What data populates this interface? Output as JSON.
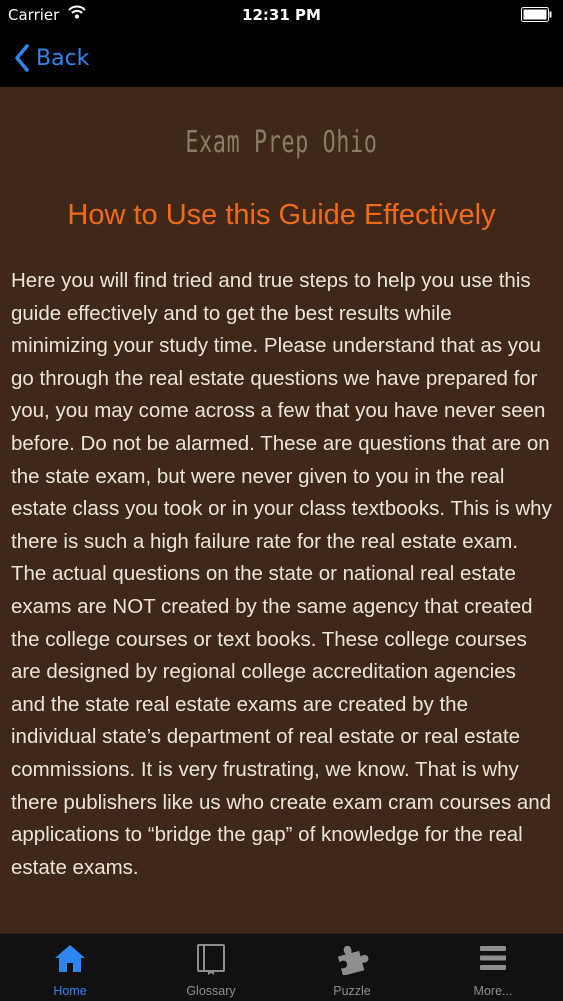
{
  "status_bar": {
    "carrier": "Carrier",
    "time": "12:31 PM"
  },
  "nav": {
    "back_label": "Back"
  },
  "content": {
    "logo_text": "Exam Prep Ohio",
    "heading": "How to Use this Guide Effectively",
    "body": "Here you will find tried and true steps to help you use this guide effectively and to get the best results while minimizing your study time. Please understand that as you go through the real estate questions we have prepared for you, you may come across a few that you have never seen before. Do not be alarmed. These are questions that are on the state exam, but were never given to you in the real estate class you took or in your class textbooks. This is why there is such a high failure rate for the real estate exam. The actual questions on the state or national real estate exams are NOT created by the same agency that created the college courses or text books. These college courses are designed by regional college accreditation agencies and the state real estate exams are created by the individual state’s department of real estate or real estate commissions. It is very frustrating, we know. That is why there publishers like us who create exam cram courses and applications to “bridge the gap” of knowledge for the real estate exams."
  },
  "tabs": [
    {
      "label": "Home",
      "icon": "home-icon",
      "active": true
    },
    {
      "label": "Glossary",
      "icon": "book-icon",
      "active": false
    },
    {
      "label": "Puzzle",
      "icon": "puzzle-icon",
      "active": false
    },
    {
      "label": "More...",
      "icon": "more-icon",
      "active": false
    }
  ],
  "colors": {
    "accent": "#2f86f0",
    "content_background": "#3f2817",
    "heading": "#f16a1b"
  }
}
